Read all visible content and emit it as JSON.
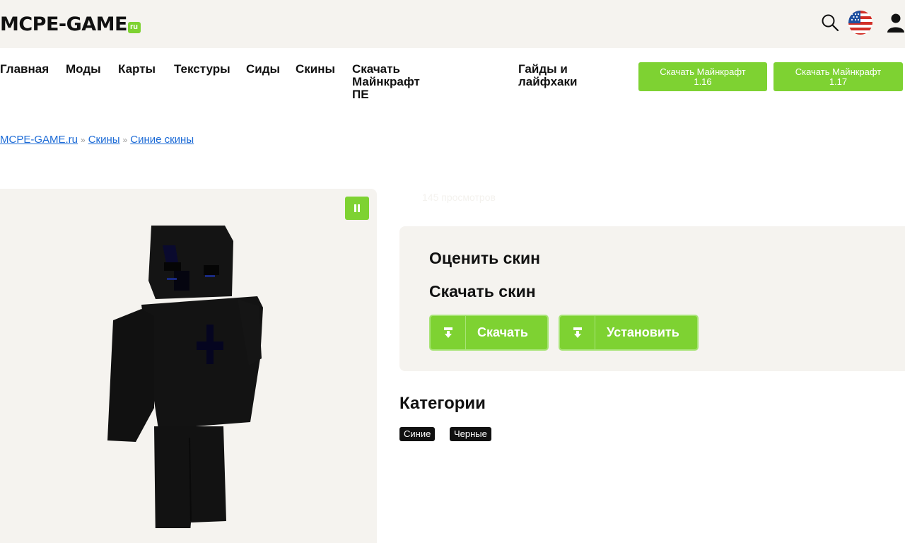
{
  "header": {
    "logo_main": "MCPE-GAME",
    "logo_ru": "ru",
    "icons": {
      "search": "search-icon",
      "flag": "us-flag-icon",
      "user": "user-icon"
    }
  },
  "nav": {
    "items": [
      {
        "label": "Главная"
      },
      {
        "label": "Моды"
      },
      {
        "label": "Карты"
      },
      {
        "label": "Текстуры"
      },
      {
        "label": "Сиды"
      },
      {
        "label": "Скины"
      },
      {
        "label_line1": "Скачать Майнкрафт",
        "label_line2": "ПЕ"
      },
      {
        "label_line1": "Гайды и",
        "label_line2": "лайфхаки"
      }
    ],
    "download_buttons": [
      {
        "line1": "Скачать Майнкрафт",
        "line2": "1.16"
      },
      {
        "line1": "Скачать Майнкрафт",
        "line2": "1.17"
      }
    ]
  },
  "breadcrumb": {
    "items": [
      "MCPE-GAME.ru",
      "Скины",
      "Синие скины"
    ],
    "separator": "»"
  },
  "views": "145 просмотров",
  "panel": {
    "rate_title": "Оценить скин",
    "download_title": "Скачать скин",
    "download_button": "Скачать",
    "install_button": "Установить"
  },
  "categories": {
    "title": "Категории",
    "tags": [
      "Синие",
      "Черные"
    ]
  },
  "colors": {
    "accent": "#7ed232",
    "link": "#1b6ad6",
    "panel_bg": "#f5f3ef"
  }
}
